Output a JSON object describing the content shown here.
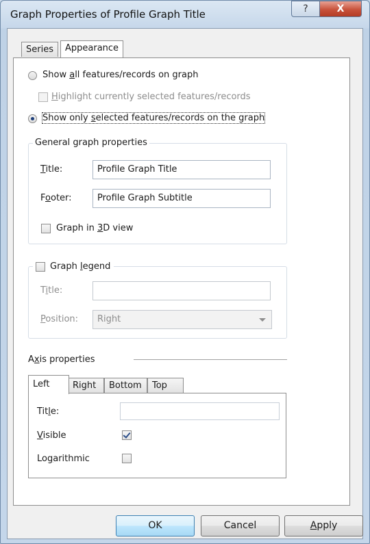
{
  "window": {
    "title": "Graph Properties of Profile Graph Title",
    "help_glyph": "?",
    "close_glyph": "X"
  },
  "tabs": [
    {
      "label": "Series"
    },
    {
      "label": "Appearance"
    }
  ],
  "appearance": {
    "radio_all": {
      "pre": "Show ",
      "key": "a",
      "post": "ll features/records on graph",
      "checked": false
    },
    "highlight": {
      "pre": "",
      "key": "H",
      "post": "ighlight currently selected features/records",
      "disabled": true,
      "checked": false
    },
    "radio_selected": {
      "pre": "Show only ",
      "key": "s",
      "post": "elected features/records on the graph",
      "checked": true
    },
    "general": {
      "title": "General graph properties",
      "title_label": {
        "pre": "",
        "key": "T",
        "post": "itle:"
      },
      "title_value": "Profile Graph Title",
      "footer_label": {
        "pre": "F",
        "key": "o",
        "post": "oter:"
      },
      "footer_value": "Profile Graph Subtitle",
      "view3d": {
        "pre": "Graph in ",
        "key": "3",
        "post": "D view",
        "checked": false
      }
    },
    "legend": {
      "checkbox": {
        "pre": "Graph ",
        "key": "l",
        "post": "egend",
        "checked": false
      },
      "title_label": {
        "pre": "T",
        "key": "i",
        "post": "tle:"
      },
      "title_value": "",
      "position_label": {
        "pre": "",
        "key": "P",
        "post": "osition:"
      },
      "position_value": "Right"
    },
    "axis": {
      "heading": {
        "pre": "A",
        "key": "x",
        "post": "is properties"
      },
      "tabs": [
        {
          "label": "Left"
        },
        {
          "label": "Right"
        },
        {
          "label": "Bottom"
        },
        {
          "label": "Top"
        }
      ],
      "title_label": {
        "pre": "Tit",
        "key": "l",
        "post": "e:"
      },
      "title_value": "",
      "visible": {
        "pre": "",
        "key": "V",
        "post": "isible",
        "checked": true
      },
      "logarithmic": {
        "pre": "Lo",
        "key": "g",
        "post": "arithmic",
        "checked": false
      }
    }
  },
  "buttons": {
    "ok": {
      "label": "OK"
    },
    "cancel": {
      "label": "Cancel"
    },
    "apply": {
      "pre": "",
      "key": "A",
      "post": "pply"
    }
  }
}
